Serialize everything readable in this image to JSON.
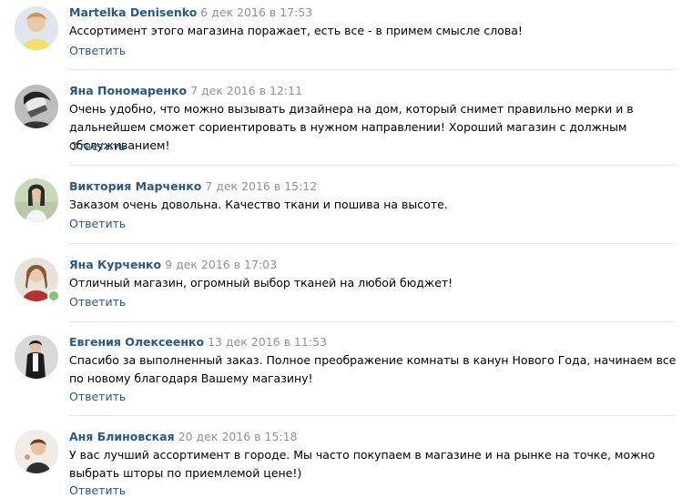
{
  "reply_label": "Ответить",
  "colors": {
    "author": "#2a5885",
    "date": "#939393",
    "separator": "#e7e8ec",
    "online": "#8ac176"
  },
  "comments": [
    {
      "author": "Martelka Denisenko",
      "date": "6 дек 2016 в 17:53",
      "text": "Ассортимент этого магазина поражает, есть все - в примем смысле слова!",
      "avatar_icon": "avatar-photo",
      "online": false
    },
    {
      "author": "Яна Пономаренко",
      "date": "7 дек 2016 в 12:11",
      "text": "Очень удобно, что можно вызывать дизайнера на дом, который снимет правильно мерки и в дальнейшем сможет сориентировать в нужном направлении! Хороший магазин с должным обслуживанием!",
      "avatar_icon": "avatar-photo",
      "online": false
    },
    {
      "author": "Виктория Марченко",
      "date": "7 дек 2016 в 15:12",
      "text": "Заказом очень довольна. Качество ткани и пошива на высоте.",
      "avatar_icon": "avatar-photo",
      "online": false
    },
    {
      "author": "Яна Курченко",
      "date": "9 дек 2016 в 17:03",
      "text": "Отличный магазин, огромный выбор тканей на любой бюджет!",
      "avatar_icon": "avatar-photo",
      "online": true
    },
    {
      "author": "Евгения Олексеенко",
      "date": "13 дек 2016 в 11:53",
      "text": "Спасибо за выполненный заказ. Полное преображение комнаты в канун Нового Года, начинаем все по новому благодаря Вашему магазину!",
      "avatar_icon": "avatar-photo",
      "online": false
    },
    {
      "author": "Аня Блиновская",
      "date": "20 дек 2016 в 15:18",
      "text": "У вас лучший ассортимент в городе. Мы часто покупаем в магазине и на рынке на точке, можно выбрать шторы по приемлемой цене!)",
      "avatar_icon": "avatar-photo",
      "online": false
    }
  ]
}
